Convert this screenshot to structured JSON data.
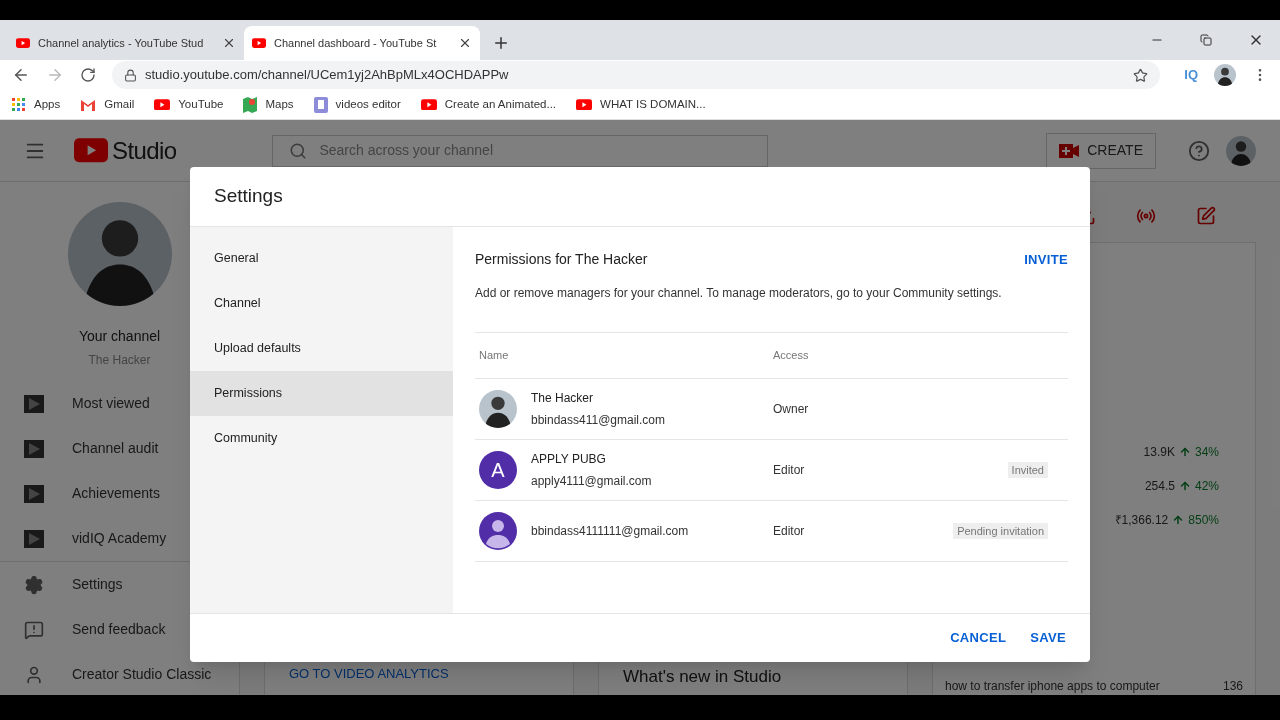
{
  "browser": {
    "tabs": [
      {
        "title": "Channel analytics - YouTube Stud",
        "selected": false
      },
      {
        "title": "Channel dashboard - YouTube St",
        "selected": true
      }
    ],
    "url": "studio.youtube.com/channel/UCem1yj2AhBpMLx4OCHDAPPw",
    "bookmarks": [
      {
        "label": "Apps",
        "kind": "apps"
      },
      {
        "label": "Gmail",
        "kind": "gmail"
      },
      {
        "label": "YouTube",
        "kind": "youtube"
      },
      {
        "label": "Maps",
        "kind": "maps"
      },
      {
        "label": "videos editor",
        "kind": "editor"
      },
      {
        "label": "Create an Animated...",
        "kind": "youtube"
      },
      {
        "label": "WHAT IS DOMAIN...",
        "kind": "youtube"
      }
    ],
    "extension": "IQ"
  },
  "studio": {
    "logo": "Studio",
    "search_placeholder": "Search across your channel",
    "create": "CREATE",
    "channel": {
      "label": "Your channel",
      "name": "The Hacker"
    },
    "nav": [
      {
        "label": "Most viewed",
        "kind": "vidiq"
      },
      {
        "label": "Channel audit",
        "kind": "vidiq"
      },
      {
        "label": "Achievements",
        "kind": "vidiq"
      },
      {
        "label": "vidIQ Academy",
        "kind": "vidiq"
      },
      {
        "label": "Settings",
        "kind": "settings"
      },
      {
        "label": "Send feedback",
        "kind": "feedback"
      },
      {
        "label": "Creator Studio Classic",
        "kind": "classic"
      }
    ],
    "analytics_link": "GO TO VIDEO ANALYTICS",
    "whats_new": "What's new in Studio",
    "stats": [
      {
        "value": "13.9K",
        "change": "34%"
      },
      {
        "value": "254.5",
        "change": "42%"
      },
      {
        "value": "₹1,366.12",
        "change": "850%"
      }
    ],
    "top_videos": [
      {
        "title": "how to transfer iphone apps to computer",
        "count": "136"
      }
    ]
  },
  "dialog": {
    "title": "Settings",
    "nav": [
      {
        "label": "General",
        "selected": false
      },
      {
        "label": "Channel",
        "selected": false
      },
      {
        "label": "Upload defaults",
        "selected": false
      },
      {
        "label": "Permissions",
        "selected": true
      },
      {
        "label": "Community",
        "selected": false
      }
    ],
    "heading": "Permissions for The Hacker",
    "invite": "INVITE",
    "description": "Add or remove managers for your channel. To manage moderators, go to your Community settings.",
    "columns": [
      "Name",
      "Access"
    ],
    "rows": [
      {
        "kind": "photo",
        "name": "The Hacker",
        "email": "bbindass411@gmail.com",
        "access": "Owner"
      },
      {
        "kind": "letter",
        "letter": "A",
        "name": "APPLY PUBG",
        "email": "apply4111@gmail.com",
        "access": "Editor",
        "status": "Invited"
      },
      {
        "kind": "generic",
        "email": "bbindass4111111@gmail.com",
        "access": "Editor",
        "status": "Pending invitation"
      }
    ],
    "cancel": "CANCEL",
    "save": "SAVE"
  }
}
